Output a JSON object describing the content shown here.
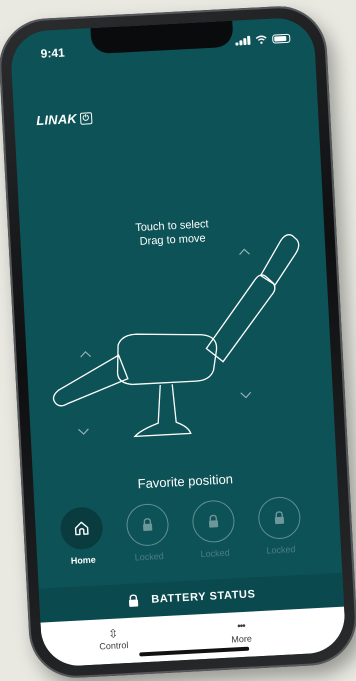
{
  "status_bar": {
    "time": "9:41"
  },
  "app": {
    "logo_text": "LINAK",
    "logo_symbol": "⏻"
  },
  "control": {
    "hint_line1": "Touch to select",
    "hint_line2": "Drag to move"
  },
  "favorites": {
    "title": "Favorite position",
    "items": [
      {
        "label": "Home",
        "icon": "home-icon",
        "active": true
      },
      {
        "label": "Locked",
        "icon": "lock-icon",
        "active": false
      },
      {
        "label": "Locked",
        "icon": "lock-icon",
        "active": false
      },
      {
        "label": "Locked",
        "icon": "lock-icon",
        "active": false
      }
    ]
  },
  "battery": {
    "label": "BATTERY STATUS",
    "icon": "lock-icon"
  },
  "tabs": [
    {
      "label": "Control",
      "icon": "chevron-up-down-icon",
      "glyph": "⇳"
    },
    {
      "label": "More",
      "icon": "more-dots-icon",
      "glyph": "•••"
    }
  ],
  "colors": {
    "background": "#0d5257",
    "accent_dark": "#093b3f",
    "battery_bar": "#0a4a4f"
  }
}
